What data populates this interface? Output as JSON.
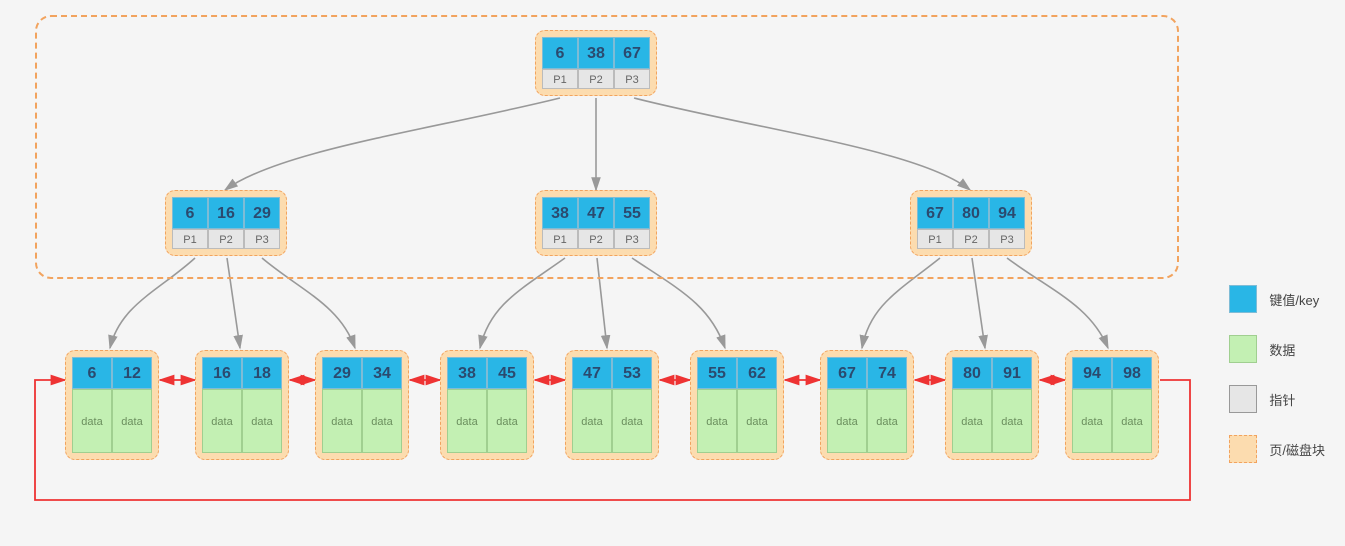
{
  "tree": {
    "root": {
      "keys": [
        6,
        38,
        67
      ],
      "ptrs": [
        "P1",
        "P2",
        "P3"
      ]
    },
    "internal": [
      {
        "keys": [
          6,
          16,
          29
        ],
        "ptrs": [
          "P1",
          "P2",
          "P3"
        ]
      },
      {
        "keys": [
          38,
          47,
          55
        ],
        "ptrs": [
          "P1",
          "P2",
          "P3"
        ]
      },
      {
        "keys": [
          67,
          80,
          94
        ],
        "ptrs": [
          "P1",
          "P2",
          "P3"
        ]
      }
    ],
    "leaves": [
      {
        "keys": [
          6,
          12
        ]
      },
      {
        "keys": [
          16,
          18
        ]
      },
      {
        "keys": [
          29,
          34
        ]
      },
      {
        "keys": [
          38,
          45
        ]
      },
      {
        "keys": [
          47,
          53
        ]
      },
      {
        "keys": [
          55,
          62
        ]
      },
      {
        "keys": [
          67,
          74
        ]
      },
      {
        "keys": [
          80,
          91
        ]
      },
      {
        "keys": [
          94,
          98
        ]
      }
    ],
    "leaf_data_label": "data"
  },
  "legend": {
    "key": "键值/key",
    "data": "数据",
    "ptr": "指针",
    "page": "页/磁盘块"
  }
}
